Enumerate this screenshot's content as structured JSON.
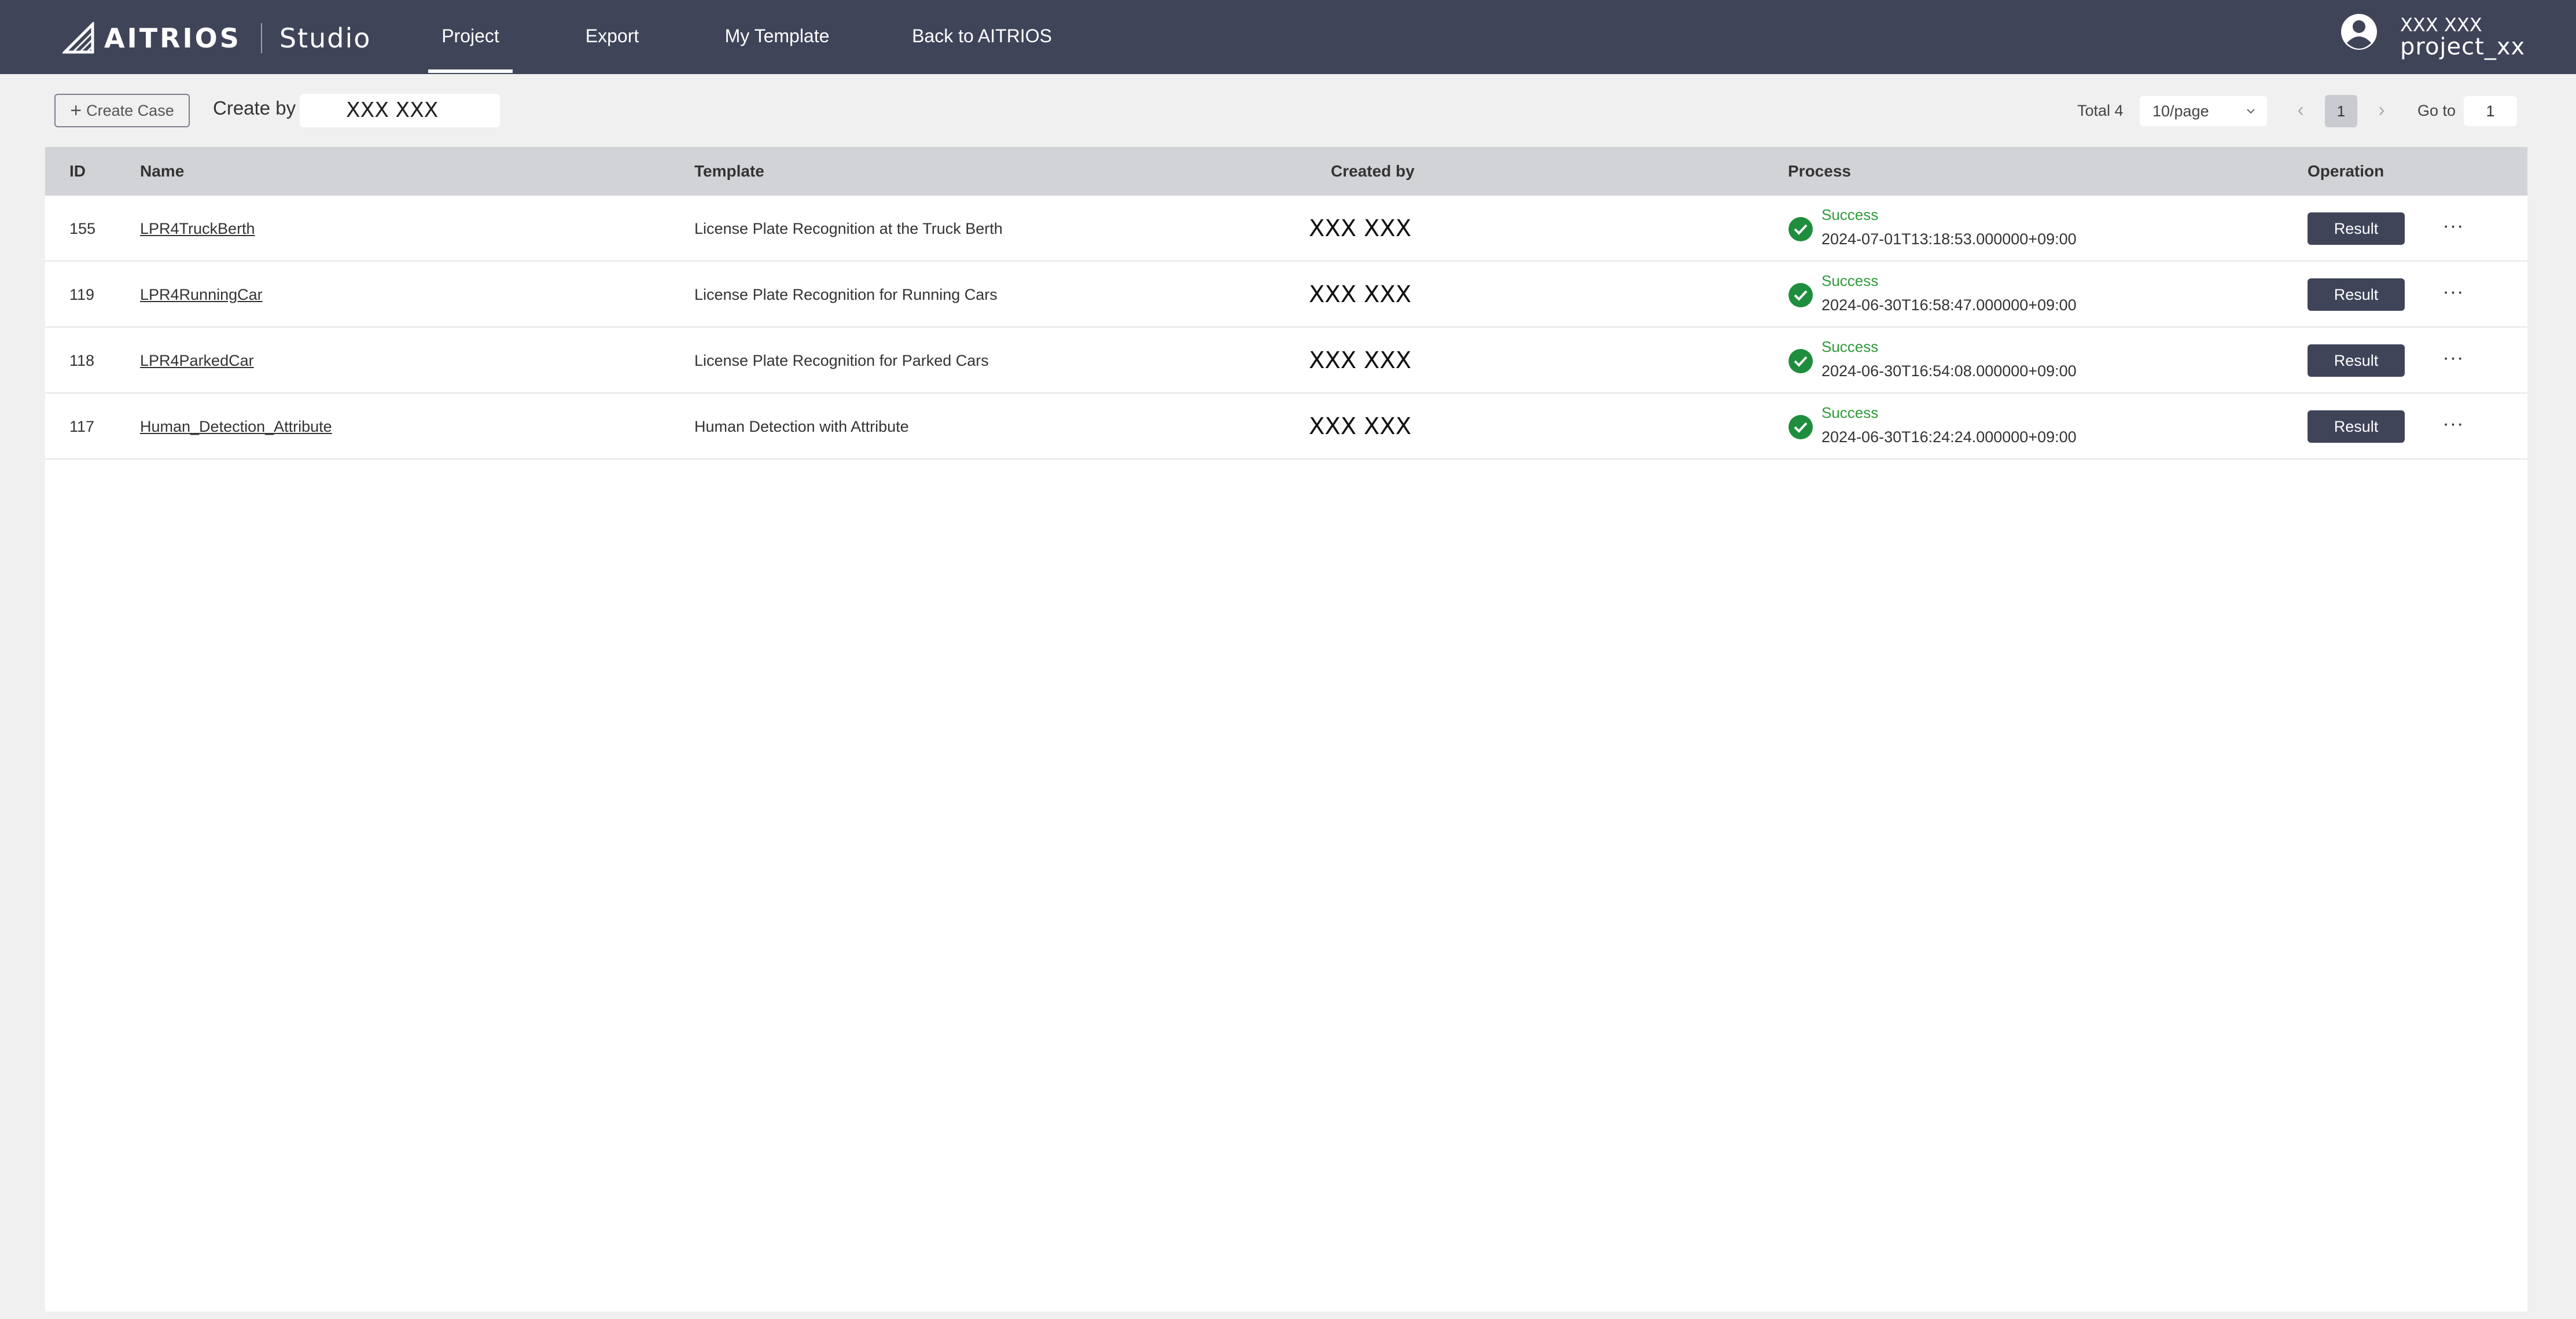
{
  "header": {
    "logo_text": "AITRIOS",
    "logo_studio": "Studio",
    "nav": [
      "Project",
      "Export",
      "My Template",
      "Back to AITRIOS"
    ],
    "active_nav": "Project",
    "user": {
      "name": "XXX XXX",
      "project": "project_xx"
    },
    "colors": {
      "background": "#3f4459",
      "text": "#ffffff"
    }
  },
  "toolbar": {
    "create_case_label": "Create Case",
    "create_by_label": "Create by",
    "create_by_value": "XXX XXX",
    "total_label": "Total 4",
    "page_size": "10/page",
    "current_page": "1",
    "goto_label": "Go to",
    "goto_value": "1"
  },
  "table": {
    "columns": [
      "ID",
      "Name",
      "Template",
      "Created by",
      "Process",
      "Operation"
    ],
    "rows": [
      {
        "id": "155",
        "name": "LPR4TruckBerth",
        "template": "License Plate Recognition at the Truck Berth",
        "created_by": "XXX XXX",
        "status": "Success",
        "date": "2024-07-01T13:18:53.000000+09:00",
        "action": "Result"
      },
      {
        "id": "119",
        "name": "LPR4RunningCar",
        "template": "License Plate Recognition for Running Cars",
        "created_by": "XXX XXX",
        "status": "Success",
        "date": "2024-06-30T16:58:47.000000+09:00",
        "action": "Result"
      },
      {
        "id": "118",
        "name": "LPR4ParkedCar",
        "template": "License Plate Recognition for Parked Cars",
        "created_by": "XXX XXX",
        "status": "Success",
        "date": "2024-06-30T16:54:08.000000+09:00",
        "action": "Result"
      },
      {
        "id": "117",
        "name": "Human_Detection_Attribute",
        "template": "Human Detection with Attribute",
        "created_by": "XXX XXX",
        "status": "Success",
        "date": "2024-06-30T16:24:24.000000+09:00",
        "action": "Result"
      }
    ],
    "colors": {
      "success": "#2f9a3a",
      "result_button": "#3f4459",
      "header_bg": "#d2d3d6"
    }
  }
}
